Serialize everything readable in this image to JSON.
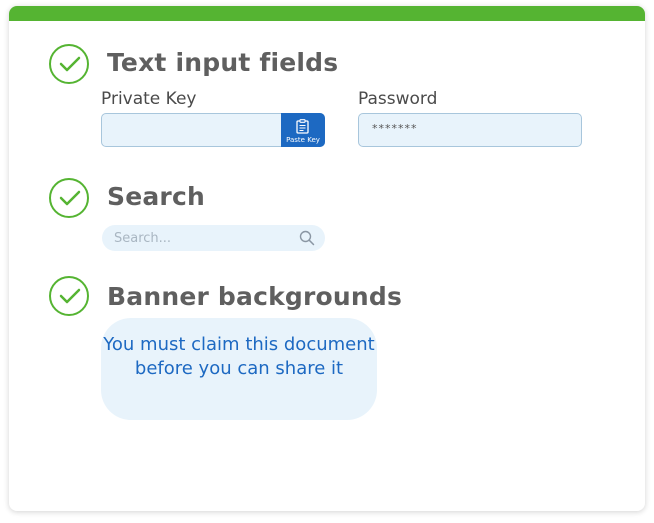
{
  "colors": {
    "accent": "#55b432",
    "primary": "#1d69c2",
    "field_bg": "#e8f3fb"
  },
  "sections": [
    {
      "title": "Text input fields",
      "icon": "check-circle-icon"
    },
    {
      "title": "Search",
      "icon": "check-circle-icon"
    },
    {
      "title": "Banner backgrounds",
      "icon": "check-circle-icon"
    }
  ],
  "private_key": {
    "label": "Private Key",
    "value": "",
    "paste_label": "Paste Key",
    "paste_icon": "clipboard-icon"
  },
  "password": {
    "label": "Password",
    "masked_value": "*******"
  },
  "search": {
    "placeholder": "Search...",
    "icon": "search-icon"
  },
  "banner": {
    "text": "You must claim this document before you can share it"
  }
}
